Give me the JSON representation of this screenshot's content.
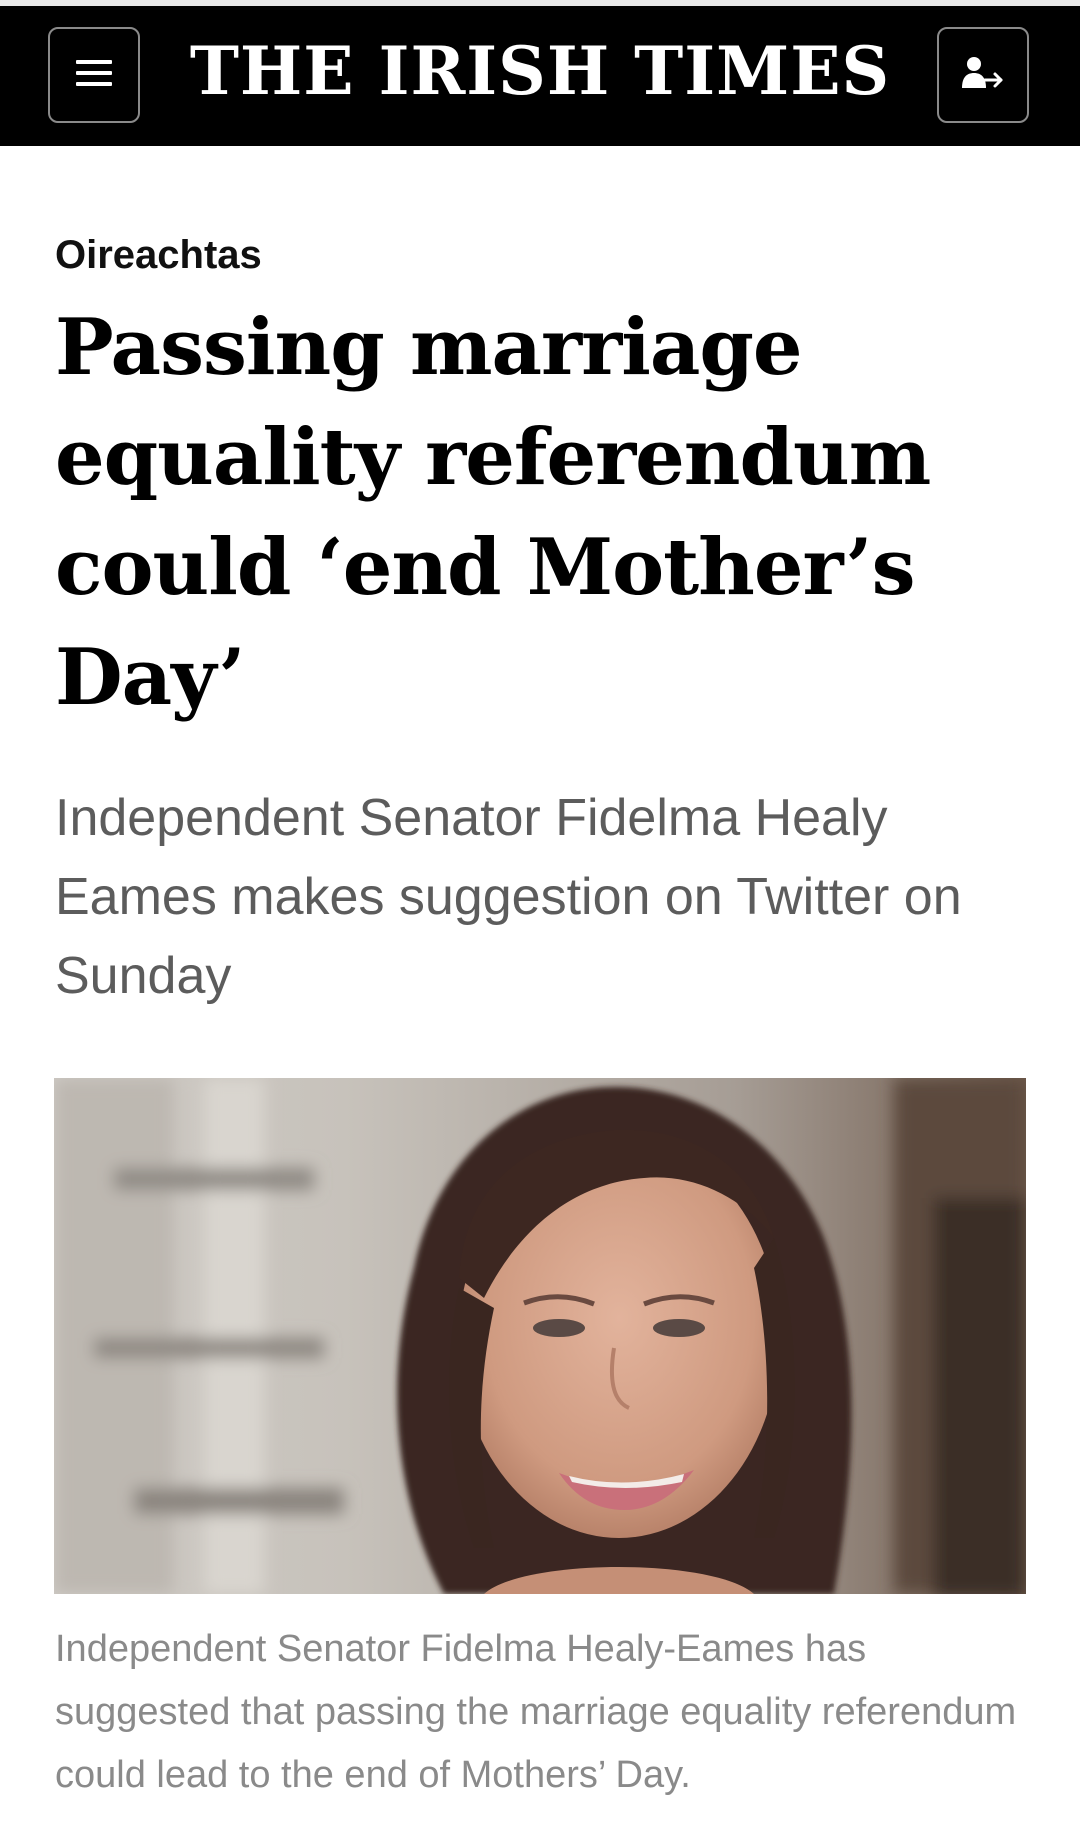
{
  "masthead": {
    "title": "THE IRISH TIMES",
    "menu_icon": "hamburger-menu-icon",
    "account_icon": "sign-in-user-icon"
  },
  "article": {
    "section": "Oireachtas",
    "headline": "Passing marriage equality referendum could ‘end Mother’s Day’",
    "standfirst": "Independent Senator Fidelma Healy Eames makes suggestion on Twitter on Sunday",
    "caption": "Independent Senator Fidelma Healy-Eames has suggested that passing the marriage equality referendum could lead to the end of Mothers’ Day."
  },
  "colors": {
    "masthead_bg": "#000000",
    "masthead_text": "#ffffff",
    "headline": "#000000",
    "standfirst": "#5c5c5c",
    "caption": "#8a8a8a"
  }
}
